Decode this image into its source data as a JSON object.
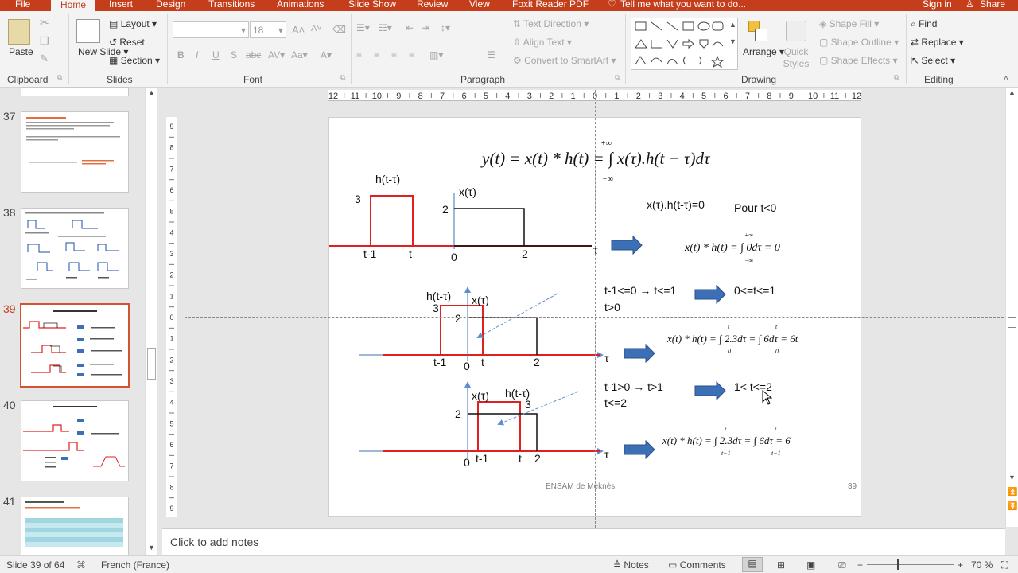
{
  "tabs": [
    "File",
    "Home",
    "Insert",
    "Design",
    "Transitions",
    "Animations",
    "Slide Show",
    "Review",
    "View",
    "Foxit Reader PDF"
  ],
  "tell_me": "Tell me what you want to do...",
  "sign_in": "Sign in",
  "share": "Share",
  "ribbon": {
    "paste": "Paste",
    "new_slide": "New Slide",
    "layout": "Layout",
    "reset": "Reset",
    "section": "Section",
    "font_size": "18",
    "text_direction": "Text Direction",
    "align_text": "Align Text",
    "convert_smartart": "Convert to SmartArt",
    "arrange": "Arrange",
    "quick_styles": "Quick Styles",
    "shape_fill": "Shape Fill",
    "shape_outline": "Shape Outline",
    "shape_effects": "Shape Effects",
    "find": "Find",
    "replace": "Replace",
    "select": "Select",
    "groups": {
      "clipboard": "Clipboard",
      "slides": "Slides",
      "font": "Font",
      "paragraph": "Paragraph",
      "drawing": "Drawing",
      "editing": "Editing"
    }
  },
  "thumbnails": [
    {
      "num": "37",
      "selected": false
    },
    {
      "num": "38",
      "selected": false
    },
    {
      "num": "39",
      "selected": true
    },
    {
      "num": "40",
      "selected": false
    },
    {
      "num": "41",
      "selected": false
    }
  ],
  "ruler": {
    "h": [
      "12",
      "11",
      "10",
      "9",
      "8",
      "7",
      "6",
      "5",
      "4",
      "3",
      "2",
      "1",
      "0",
      "1",
      "2",
      "3",
      "4",
      "5",
      "6",
      "7",
      "8",
      "9",
      "10",
      "11",
      "12"
    ],
    "v": [
      "9",
      "8",
      "7",
      "6",
      "5",
      "4",
      "3",
      "2",
      "1",
      "0",
      "1",
      "2",
      "3",
      "4",
      "5",
      "6",
      "7",
      "8",
      "9"
    ]
  },
  "slide": {
    "eq_main": "y(t) = x(t) * h(t) = ∫ x(τ).h(t − τ)dτ",
    "eq_main_lim_top": "+∞",
    "eq_main_lim_bot": "−∞",
    "panel1": {
      "h_label": "h(t-τ)",
      "x_label": "x(τ)",
      "y3": "3",
      "y2": "2",
      "t_minus_1": "t-1",
      "t": "t",
      "zero": "0",
      "two": "2",
      "tau": "τ",
      "cond1": "x(τ).h(t-τ)=0",
      "cond2": "Pour t<0",
      "result": "x(t) * h(t) = ∫ 0dτ = 0",
      "res_top": "+∞",
      "res_bot": "−∞"
    },
    "panel2": {
      "h_label": "h(t-τ)",
      "x_label": "x(τ)",
      "y3": "3",
      "y2": "2",
      "t_minus_1": "t-1",
      "zero": "0",
      "t": "t",
      "two": "2",
      "tau": "τ",
      "cond1": "t-1<=0 → t<=1",
      "cond2": "t>0",
      "range": "0<=t<=1",
      "result": "x(t) * h(t) = ∫ 2.3dτ = ∫ 6dτ = 6t",
      "res_top1": "t",
      "res_bot1": "0",
      "res_top2": "t",
      "res_bot2": "0"
    },
    "panel3": {
      "h_label": "h(t-τ)",
      "x_label": "x(τ)",
      "y3": "3",
      "y2": "2",
      "zero": "0",
      "t_minus_1": "t-1",
      "t": "t",
      "two": "2",
      "tau": "τ",
      "cond1": "t-1>0 → t>1",
      "cond2": "t<=2",
      "range": "1< t<=2",
      "result": "x(t) * h(t) = ∫ 2.3dτ = ∫ 6dτ = 6",
      "res_top1": "t",
      "res_bot1": "t−1",
      "res_top2": "t",
      "res_bot2": "t−1"
    },
    "footer": "ENSAM de Meknès",
    "page": "39"
  },
  "notes_placeholder": "Click to add notes",
  "status": {
    "slide_info": "Slide 39 of 64",
    "language": "French (France)",
    "notes": "Notes",
    "comments": "Comments",
    "zoom": "70 %"
  },
  "colors": {
    "accent": "#c43e1c",
    "signal_red": "#e02020",
    "arrow_blue": "#3d6fb6"
  }
}
